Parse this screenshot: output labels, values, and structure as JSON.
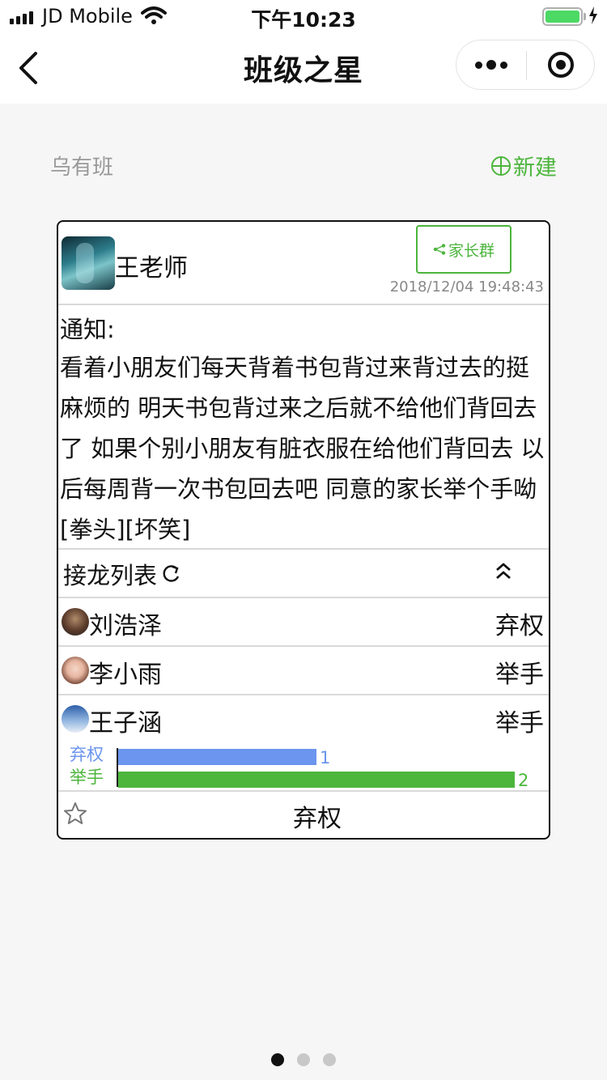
{
  "status_bar": {
    "carrier": "JD Mobile",
    "time": "下午10:23",
    "battery_level": 1.0
  },
  "nav": {
    "title": "班级之星"
  },
  "class_header": {
    "class_name": "乌有班",
    "new_label": "新建"
  },
  "post": {
    "author": "王老师",
    "share_label": "家长群",
    "timestamp": "2018/12/04 19:48:43",
    "notice_label": "通知:",
    "notice_body": "看着小朋友们每天背着书包背过来背过去的挺麻烦的 明天书包背过来之后就不给他们背回去了 如果个别小朋友有脏衣服在给他们背回去 以后每周背一次书包回去吧 同意的家长举个手呦[拳头][坏笑]"
  },
  "jielong": {
    "label": "接龙列表",
    "entries": [
      {
        "name": "刘浩泽",
        "vote": "弃权"
      },
      {
        "name": "李小雨",
        "vote": "举手"
      },
      {
        "name": "王子涵",
        "vote": "举手"
      }
    ]
  },
  "chart_data": {
    "type": "bar",
    "orientation": "horizontal",
    "categories": [
      "弃权",
      "举手"
    ],
    "values": [
      1,
      2
    ],
    "colors": [
      "#6b95ee",
      "#4cb53c"
    ]
  },
  "footer": {
    "action_label": "弃权"
  },
  "pager": {
    "count": 3,
    "active": 0
  },
  "colors": {
    "accent": "#4cb53c",
    "abstain": "#6b95ee",
    "raise": "#4cb53c"
  }
}
